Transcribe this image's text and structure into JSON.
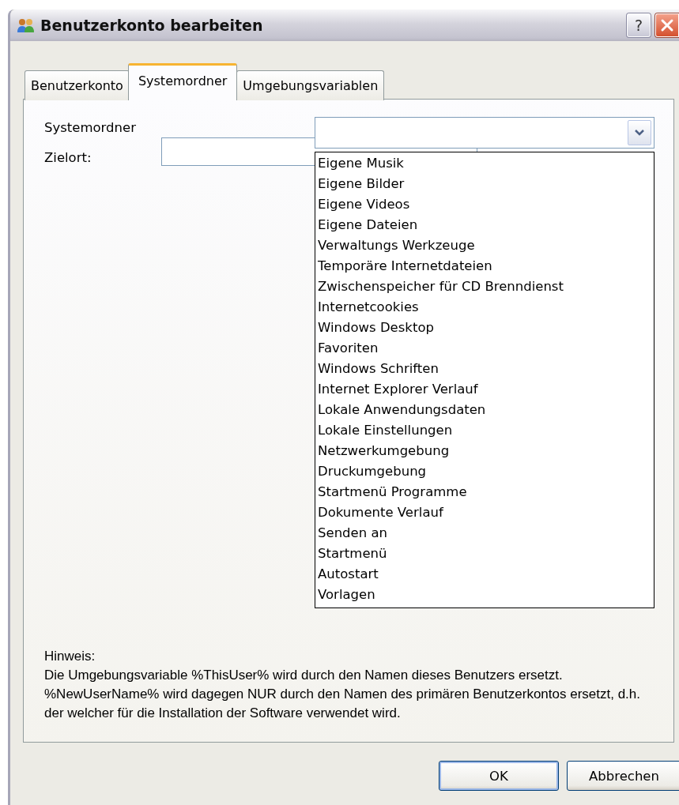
{
  "window": {
    "title": "Benutzerkonto bearbeiten",
    "help_button": "?"
  },
  "tabs": [
    {
      "label": "Benutzerkonto",
      "selected": false
    },
    {
      "label": "Systemordner",
      "selected": true
    },
    {
      "label": "Umgebungsvariablen",
      "selected": false
    }
  ],
  "system_folder": {
    "label": "Systemordner",
    "expanded": true,
    "options": [
      {
        "label": "Eigene Musik",
        "selected": false
      },
      {
        "label": "Eigene Bilder",
        "selected": false
      },
      {
        "label": "Eigene Videos",
        "selected": false
      },
      {
        "label": "Eigene Dateien",
        "selected": false
      },
      {
        "label": "Verwaltungs Werkzeuge",
        "selected": false
      },
      {
        "label": "Temporäre Internetdateien",
        "selected": false
      },
      {
        "label": "Zwischenspeicher für CD Brenndienst",
        "selected": false
      },
      {
        "label": "Internetcookies",
        "selected": false
      },
      {
        "label": "Windows Desktop",
        "selected": false
      },
      {
        "label": "Favoriten",
        "selected": false
      },
      {
        "label": "Windows Schriften",
        "selected": false
      },
      {
        "label": "Internet Explorer Verlauf",
        "selected": false
      },
      {
        "label": "Lokale Anwendungsdaten",
        "selected": false
      },
      {
        "label": "Lokale Einstellungen",
        "selected": false
      },
      {
        "label": "Netzwerkumgebung",
        "selected": false
      },
      {
        "label": "Druckumgebung",
        "selected": false
      },
      {
        "label": "Startmenü Programme",
        "selected": false
      },
      {
        "label": "Dokumente Verlauf",
        "selected": false
      },
      {
        "label": "Senden an",
        "selected": false
      },
      {
        "label": "Startmenü",
        "selected": false
      },
      {
        "label": "Autostart",
        "selected": false
      },
      {
        "label": "Vorlagen",
        "selected": false
      }
    ]
  },
  "target": {
    "label": "Zielort:"
  },
  "note": {
    "title": "Hinweis:",
    "text": "Die Umgebungsvariable %ThisUser% wird durch den Namen dieses Benutzers ersetzt. %NewUserName% wird dagegen NUR durch den Namen des primären Benutzerkontos ersetzt, d.h. der welcher für die Installation der Software verwendet wird."
  },
  "buttons": [
    {
      "label": "OK",
      "default": true
    },
    {
      "label": "Abbrechen",
      "default": false
    }
  ]
}
